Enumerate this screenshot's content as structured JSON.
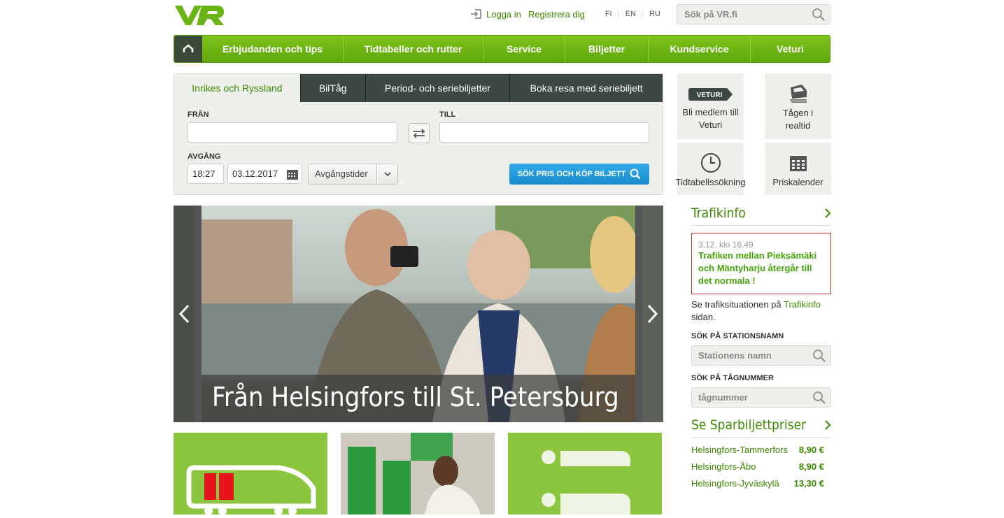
{
  "header": {
    "logo_text": "VR",
    "login_label": "Logga in",
    "register_label": "Registrera dig",
    "languages": [
      "FI",
      "EN",
      "RU"
    ],
    "search_placeholder": "Sök på VR.fi"
  },
  "nav": {
    "items": [
      "Erbjudanden och tips",
      "Tidtabeller och rutter",
      "Service",
      "Biljetter",
      "Kundservice",
      "Veturi"
    ]
  },
  "booking": {
    "tabs": [
      "Inrikes och Ryssland",
      "BilTåg",
      "Period- och seriebiljetter",
      "Boka resa med seriebiljett"
    ],
    "from_label": "FRÅN",
    "to_label": "TILL",
    "departure_label": "AVGÅNG",
    "time_value": "18:27",
    "date_value": "03.12.2017",
    "departure_times_label": "Avgångstider",
    "search_button": "SÖK PRIS OCH KÖP BILJETT"
  },
  "tiles": [
    {
      "label": "Bli medlem till Veturi",
      "icon": "veturi-badge-icon",
      "badge": "VETURI"
    },
    {
      "label": "Tågen i realtid",
      "icon": "train-icon"
    },
    {
      "label": "Tidtabellssökning",
      "icon": "clock-icon"
    },
    {
      "label": "Priskalender",
      "icon": "calendar-icon"
    }
  ],
  "hero": {
    "caption": "Från Helsingfors till St. Petersburg"
  },
  "traffic": {
    "title": "Trafikinfo",
    "alert_time": "3.12. klo 16.49",
    "alert_message": "Trafiken mellan Pieksämäki och Mäntyharju återgår till det normala !",
    "info_prefix": "Se trafiksituationen på ",
    "info_link": "Trafikinfo",
    "info_suffix": " sidan.",
    "station_search_label": "SÖK PÅ STATIONSNAMN",
    "station_placeholder": "Stationens namn",
    "train_search_label": "SÖK PÅ TÅGNUMMER",
    "train_placeholder": "tågnummer"
  },
  "prices": {
    "title": "Se Sparbiljettpriser",
    "rows": [
      {
        "route": "Helsingfors-Tammerfors",
        "price": "8,90 €"
      },
      {
        "route": "Helsingfors-Åbo",
        "price": "8,90 €"
      },
      {
        "route": "Helsingfors-Jyväskylä",
        "price": "13,30 €"
      }
    ]
  },
  "colors": {
    "brand_green": "#6ab415",
    "link_green": "#3b8a00",
    "alert_red": "#c8302f",
    "button_blue": "#1a8cd0"
  }
}
